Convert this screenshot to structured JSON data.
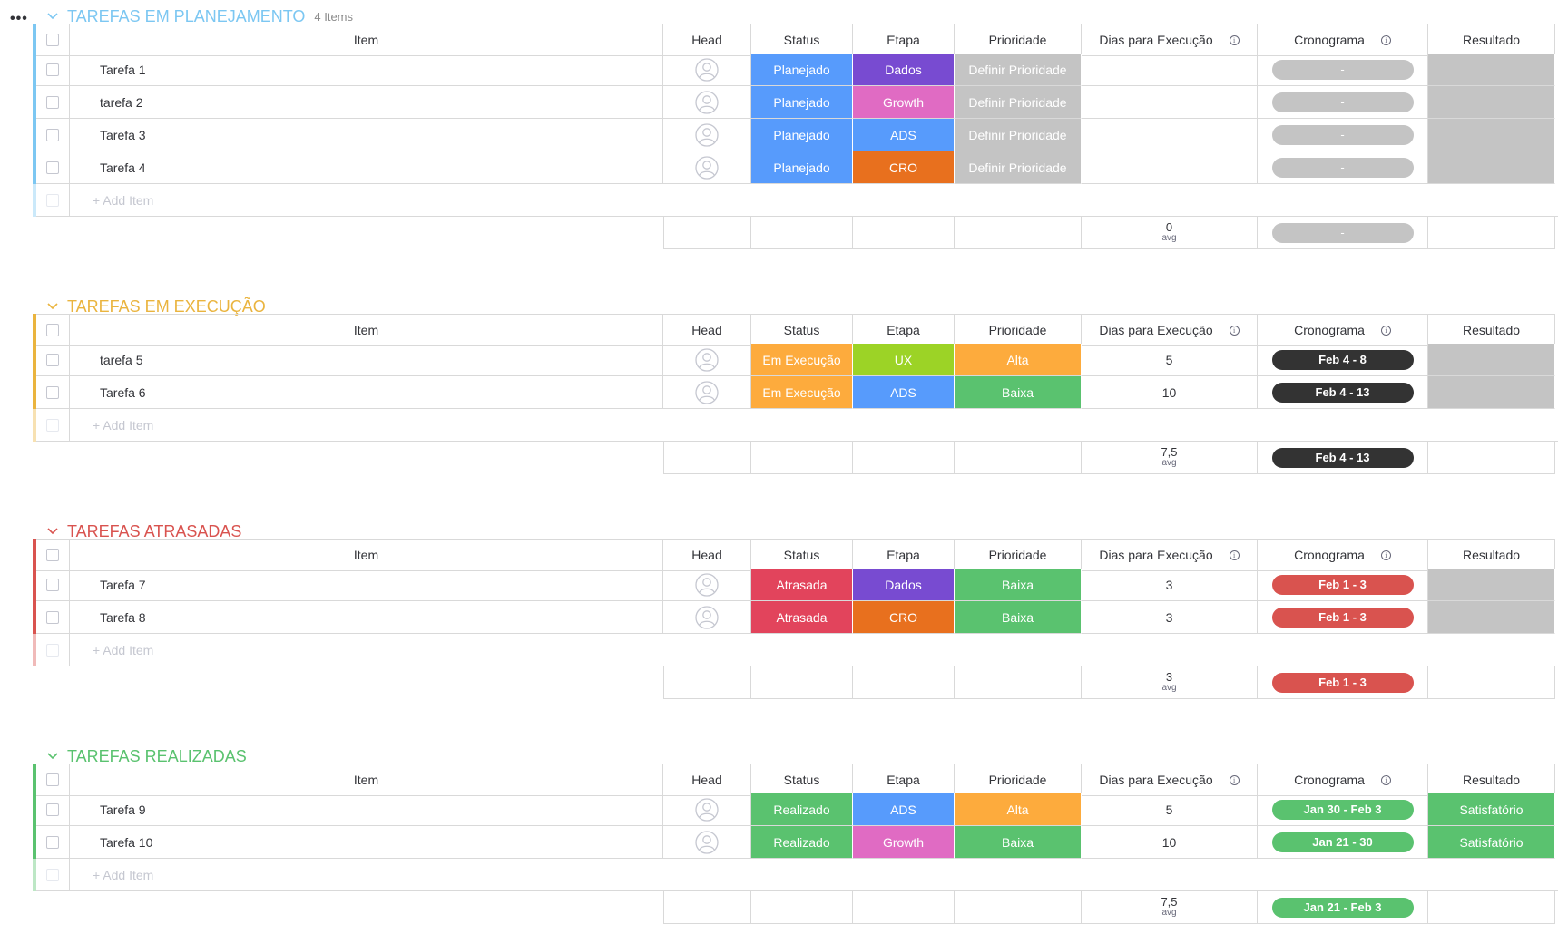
{
  "menu_glyph": "•••",
  "columns": {
    "item": "Item",
    "head": "Head",
    "status": "Status",
    "etapa": "Etapa",
    "prioridade": "Prioridade",
    "dias": "Dias para Execução",
    "cronograma": "Cronograma",
    "resultado": "Resultado"
  },
  "info_glyph": "i",
  "add_item_label": "+ Add Item",
  "avg_label": "avg",
  "groups": [
    {
      "title": "TAREFAS EM PLANEJAMENTO",
      "count": "4 Items",
      "color": "#7cc7f2",
      "items": [
        {
          "name": "Tarefa 1",
          "status": "Planejado",
          "status_color": "#579bfc",
          "etapa": "Dados",
          "etapa_color": "#784bd1",
          "prioridade": "Definir Prioridade",
          "prio_color": "#c4c4c4",
          "dias": "",
          "crono": "-",
          "crono_color": "#c4c4c4",
          "resultado": "",
          "res_color": "#c4c4c4"
        },
        {
          "name": "tarefa 2",
          "status": "Planejado",
          "status_color": "#579bfc",
          "etapa": "Growth",
          "etapa_color": "#e06bc3",
          "prioridade": "Definir Prioridade",
          "prio_color": "#c4c4c4",
          "dias": "",
          "crono": "-",
          "crono_color": "#c4c4c4",
          "resultado": "",
          "res_color": "#c4c4c4"
        },
        {
          "name": "Tarefa 3",
          "status": "Planejado",
          "status_color": "#579bfc",
          "etapa": "ADS",
          "etapa_color": "#579bfc",
          "prioridade": "Definir Prioridade",
          "prio_color": "#c4c4c4",
          "dias": "",
          "crono": "-",
          "crono_color": "#c4c4c4",
          "resultado": "",
          "res_color": "#c4c4c4"
        },
        {
          "name": "Tarefa 4",
          "status": "Planejado",
          "status_color": "#579bfc",
          "etapa": "CRO",
          "etapa_color": "#e8701e",
          "prioridade": "Definir Prioridade",
          "prio_color": "#c4c4c4",
          "dias": "",
          "crono": "-",
          "crono_color": "#c4c4c4",
          "resultado": "",
          "res_color": "#c4c4c4"
        }
      ],
      "summary": {
        "dias": "0",
        "crono": "-",
        "crono_color": "#c4c4c4"
      }
    },
    {
      "title": "TAREFAS EM EXECUÇÃO",
      "count": "",
      "color": "#eab43e",
      "items": [
        {
          "name": "tarefa 5",
          "status": "Em Execução",
          "status_color": "#fdab3d",
          "etapa": "UX",
          "etapa_color": "#9cd326",
          "prioridade": "Alta",
          "prio_color": "#fdab3d",
          "dias": "5",
          "crono": "Feb 4 - 8",
          "crono_color": "#333333",
          "resultado": "",
          "res_color": "#c4c4c4"
        },
        {
          "name": "Tarefa 6",
          "status": "Em Execução",
          "status_color": "#fdab3d",
          "etapa": "ADS",
          "etapa_color": "#579bfc",
          "prioridade": "Baixa",
          "prio_color": "#5ac26f",
          "dias": "10",
          "crono": "Feb 4 - 13",
          "crono_color": "#333333",
          "resultado": "",
          "res_color": "#c4c4c4"
        }
      ],
      "summary": {
        "dias": "7,5",
        "crono": "Feb 4 - 13",
        "crono_color": "#333333"
      }
    },
    {
      "title": "TAREFAS ATRASADAS",
      "count": "",
      "color": "#d9534f",
      "items": [
        {
          "name": "Tarefa 7",
          "status": "Atrasada",
          "status_color": "#e2445c",
          "etapa": "Dados",
          "etapa_color": "#784bd1",
          "prioridade": "Baixa",
          "prio_color": "#5ac26f",
          "dias": "3",
          "crono": "Feb 1 - 3",
          "crono_color": "#d9534f",
          "resultado": "",
          "res_color": "#c4c4c4"
        },
        {
          "name": "Tarefa 8",
          "status": "Atrasada",
          "status_color": "#e2445c",
          "etapa": "CRO",
          "etapa_color": "#e8701e",
          "prioridade": "Baixa",
          "prio_color": "#5ac26f",
          "dias": "3",
          "crono": "Feb 1 - 3",
          "crono_color": "#d9534f",
          "resultado": "",
          "res_color": "#c4c4c4"
        }
      ],
      "summary": {
        "dias": "3",
        "crono": "Feb 1 - 3",
        "crono_color": "#d9534f"
      }
    },
    {
      "title": "TAREFAS REALIZADAS",
      "count": "",
      "color": "#5ac26f",
      "items": [
        {
          "name": "Tarefa 9",
          "status": "Realizado",
          "status_color": "#5ac26f",
          "etapa": "ADS",
          "etapa_color": "#579bfc",
          "prioridade": "Alta",
          "prio_color": "#fdab3d",
          "dias": "5",
          "crono": "Jan 30 - Feb 3",
          "crono_color": "#5ac26f",
          "resultado": "Satisfatório",
          "res_color": "#5ac26f"
        },
        {
          "name": "Tarefa 10",
          "status": "Realizado",
          "status_color": "#5ac26f",
          "etapa": "Growth",
          "etapa_color": "#e06bc3",
          "prioridade": "Baixa",
          "prio_color": "#5ac26f",
          "dias": "10",
          "crono": "Jan 21 - 30",
          "crono_color": "#5ac26f",
          "resultado": "Satisfatório",
          "res_color": "#5ac26f"
        }
      ],
      "summary": {
        "dias": "7,5",
        "crono": "Jan 21 - Feb 3",
        "crono_color": "#5ac26f"
      }
    }
  ]
}
